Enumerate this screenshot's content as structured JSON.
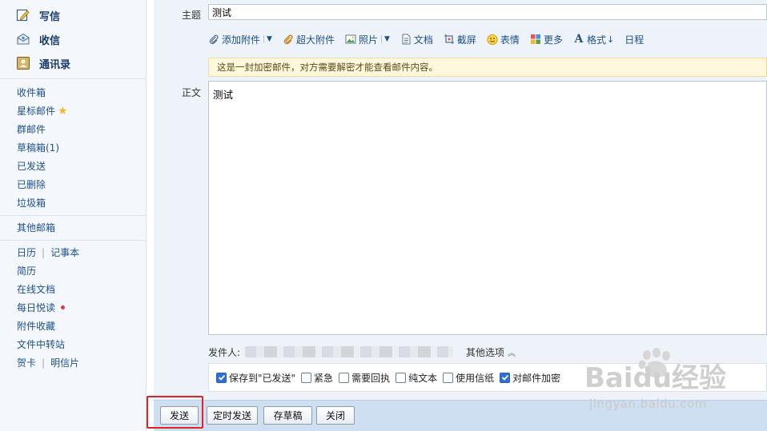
{
  "sidebar": {
    "actions": [
      {
        "label": "写信",
        "icon": "compose-icon"
      },
      {
        "label": "收信",
        "icon": "inbox-receive-icon"
      },
      {
        "label": "通讯录",
        "icon": "contacts-icon"
      }
    ],
    "folders": [
      "收件箱",
      "星标邮件",
      "群邮件",
      "草稿箱(1)",
      "已发送",
      "已删除",
      "垃圾箱"
    ],
    "other_mailbox": "其他邮箱",
    "tools": {
      "calendar": "日历",
      "notes": "记事本",
      "resume": "简历",
      "online_docs": "在线文档",
      "daily_reading": "每日悦读",
      "attachment_collection": "附件收藏",
      "file_transfer": "文件中转站",
      "greeting_card": "贺卡",
      "postcard": "明信片",
      "separator": "|"
    }
  },
  "compose": {
    "subject_label": "主题",
    "subject_value": "测试",
    "toolbar": {
      "add_attachment": "添加附件",
      "large_attachment": "超大附件",
      "photo": "照片",
      "document": "文档",
      "screenshot": "截屏",
      "emoji": "表情",
      "more": "更多",
      "format": "格式",
      "schedule": "日程"
    },
    "encryption_notice": "这是一封加密邮件，对方需要解密才能查看邮件内容。",
    "body_label": "正文",
    "body_value": "测试",
    "sender_label": "发件人:",
    "other_options": "其他选项",
    "options": [
      {
        "label": "保存到\"已发送\"",
        "checked": true
      },
      {
        "label": "紧急",
        "checked": false
      },
      {
        "label": "需要回执",
        "checked": false
      },
      {
        "label": "纯文本",
        "checked": false
      },
      {
        "label": "使用信纸",
        "checked": false
      },
      {
        "label": "对邮件加密",
        "checked": true
      }
    ]
  },
  "buttons": {
    "send": "发送",
    "scheduled_send": "定时发送",
    "save_draft": "存草稿",
    "close": "关闭"
  },
  "watermark": {
    "brand": "Baidu经验",
    "url": "jingyan.baidu.com"
  },
  "colors": {
    "link": "#1d4f8a",
    "accent_check": "#2f6fd6",
    "highlight_red": "#e02424",
    "notice_bg": "#fff8dc"
  }
}
